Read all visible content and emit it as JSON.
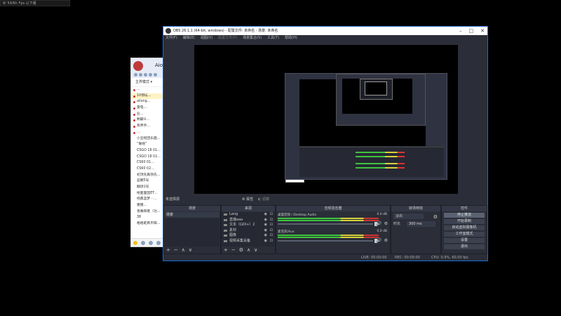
{
  "notification": {
    "text": "8/ 59/6h Fps 以下版"
  },
  "chat": {
    "username": "Aiol",
    "mode_label": "主界模式 ▾",
    "items": [
      "...",
      "10惊坛…",
      "ailong…",
      "雷电…",
      "业…",
      "剩最U…",
      "有师手…",
      "…",
      "小全程团乐面…",
      "“联络”",
      "CSGO 18 01…",
      "CSGO 18 02…",
      "CS60 01…",
      "CS60 02…",
      "初顶先再领先…",
      "蓝朝5号",
      "翻颂1号",
      "绘面面因ET…",
      "经典蓝梦 - …",
      "猪猪…",
      "善幕辉者（功…",
      "38",
      "格格乾商市辉…"
    ]
  },
  "obs": {
    "title": "OBS 26.1.1 (64-bit, windows) - 配置文件: 未命名 - 场景: 未命名",
    "menu": [
      "文件(F)",
      "编辑(E)",
      "视图(V)",
      "配置文件(P)",
      "场景集合(S)",
      "工具(T)",
      "帮助(H)"
    ],
    "no_source": "未选择源",
    "properties": "属性",
    "filters": "滤镜",
    "docks": {
      "scenes": {
        "title": "场景",
        "selected": "场景"
      },
      "sources": {
        "title": "来源",
        "items": [
          "Lang",
          "直播aaa",
          "文本（GDI+）2",
          "素材",
          "图像",
          "视频采集设备"
        ]
      },
      "mixer": {
        "title": "音频混音器",
        "tracks": [
          {
            "name": "桌面音频 / Desktop Audio",
            "db": "0.0 dB"
          },
          {
            "name": "麦克风/Aux",
            "db": "0.0 dB"
          }
        ]
      },
      "transitions": {
        "title": "转场特效",
        "type": "淡出",
        "duration_label": "时长",
        "duration_value": "300 ms"
      },
      "controls": {
        "title": "控件",
        "buttons": [
          "停止推流",
          "开始录制",
          "启动虚拟摄像机",
          "工作室模式",
          "设置",
          "退出"
        ]
      }
    },
    "status": {
      "live": "LIVE: 00:00:00",
      "rec": "REC: 00:00:00",
      "cpu": "CPU: 0.9%, 60.00 fps"
    }
  }
}
